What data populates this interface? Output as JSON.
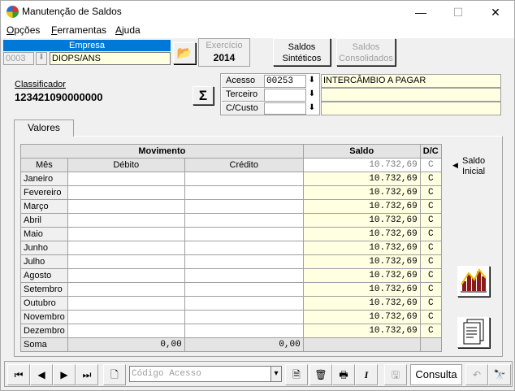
{
  "window": {
    "title": "Manutenção de Saldos",
    "minimize": "—",
    "maximize": "☐",
    "close": "✕"
  },
  "menu": [
    {
      "label": "Opções"
    },
    {
      "label": "Ferramentas"
    },
    {
      "label": "Ajuda"
    }
  ],
  "empresa": {
    "header": "Empresa",
    "code": "0003",
    "name": "DIOPS/ANS"
  },
  "exercicio": {
    "label": "Exercício",
    "value": "2014"
  },
  "buttons": {
    "saldos_sinteticos_line1": "Saldos",
    "saldos_sinteticos_line2": "Sintéticos",
    "saldos_consolidados_line1": "Saldos",
    "saldos_consolidados_line2": "Consolidados",
    "sigma": "Σ",
    "saldo_inicial_line1": "Saldo",
    "saldo_inicial_line2": "Inicial"
  },
  "classificador": {
    "label": "Classificador",
    "value": "123421090000000"
  },
  "conta": {
    "acesso_label": "Acesso",
    "acesso_value": "00253",
    "acesso_desc": "INTERCÂMBIO A PAGAR",
    "terceiro_label": "Terceiro",
    "terceiro_value": "",
    "ccusto_label": "C/Custo",
    "ccusto_value": ""
  },
  "tab": {
    "label": "Valores"
  },
  "grid": {
    "group_movimento": "Movimento",
    "group_saldo": "Saldo",
    "group_dc": "D/C",
    "col_mes": "Mês",
    "col_debito": "Débito",
    "col_credito": "Crédito",
    "initial_saldo": "10.732,69",
    "initial_dc": "C",
    "rows": [
      {
        "mes": "Janeiro",
        "debito": "",
        "credito": "",
        "saldo": "10.732,69",
        "dc": "C"
      },
      {
        "mes": "Fevereiro",
        "debito": "",
        "credito": "",
        "saldo": "10.732,69",
        "dc": "C"
      },
      {
        "mes": "Março",
        "debito": "",
        "credito": "",
        "saldo": "10.732,69",
        "dc": "C"
      },
      {
        "mes": "Abril",
        "debito": "",
        "credito": "",
        "saldo": "10.732,69",
        "dc": "C"
      },
      {
        "mes": "Maio",
        "debito": "",
        "credito": "",
        "saldo": "10.732,69",
        "dc": "C"
      },
      {
        "mes": "Junho",
        "debito": "",
        "credito": "",
        "saldo": "10.732,69",
        "dc": "C"
      },
      {
        "mes": "Julho",
        "debito": "",
        "credito": "",
        "saldo": "10.732,69",
        "dc": "C"
      },
      {
        "mes": "Agosto",
        "debito": "",
        "credito": "",
        "saldo": "10.732,69",
        "dc": "C"
      },
      {
        "mes": "Setembro",
        "debito": "",
        "credito": "",
        "saldo": "10.732,69",
        "dc": "C"
      },
      {
        "mes": "Outubro",
        "debito": "",
        "credito": "",
        "saldo": "10.732,69",
        "dc": "C"
      },
      {
        "mes": "Novembro",
        "debito": "",
        "credito": "",
        "saldo": "10.732,69",
        "dc": "C"
      },
      {
        "mes": "Dezembro",
        "debito": "",
        "credito": "",
        "saldo": "10.732,69",
        "dc": "C"
      }
    ],
    "soma_label": "Soma",
    "soma_debito": "0,00",
    "soma_credito": "0,00"
  },
  "toolbar": {
    "search_placeholder": "Código Acesso",
    "mode": "Consulta"
  },
  "colors": {
    "accent": "#0078d7",
    "yellow_field": "#ffffe1"
  }
}
